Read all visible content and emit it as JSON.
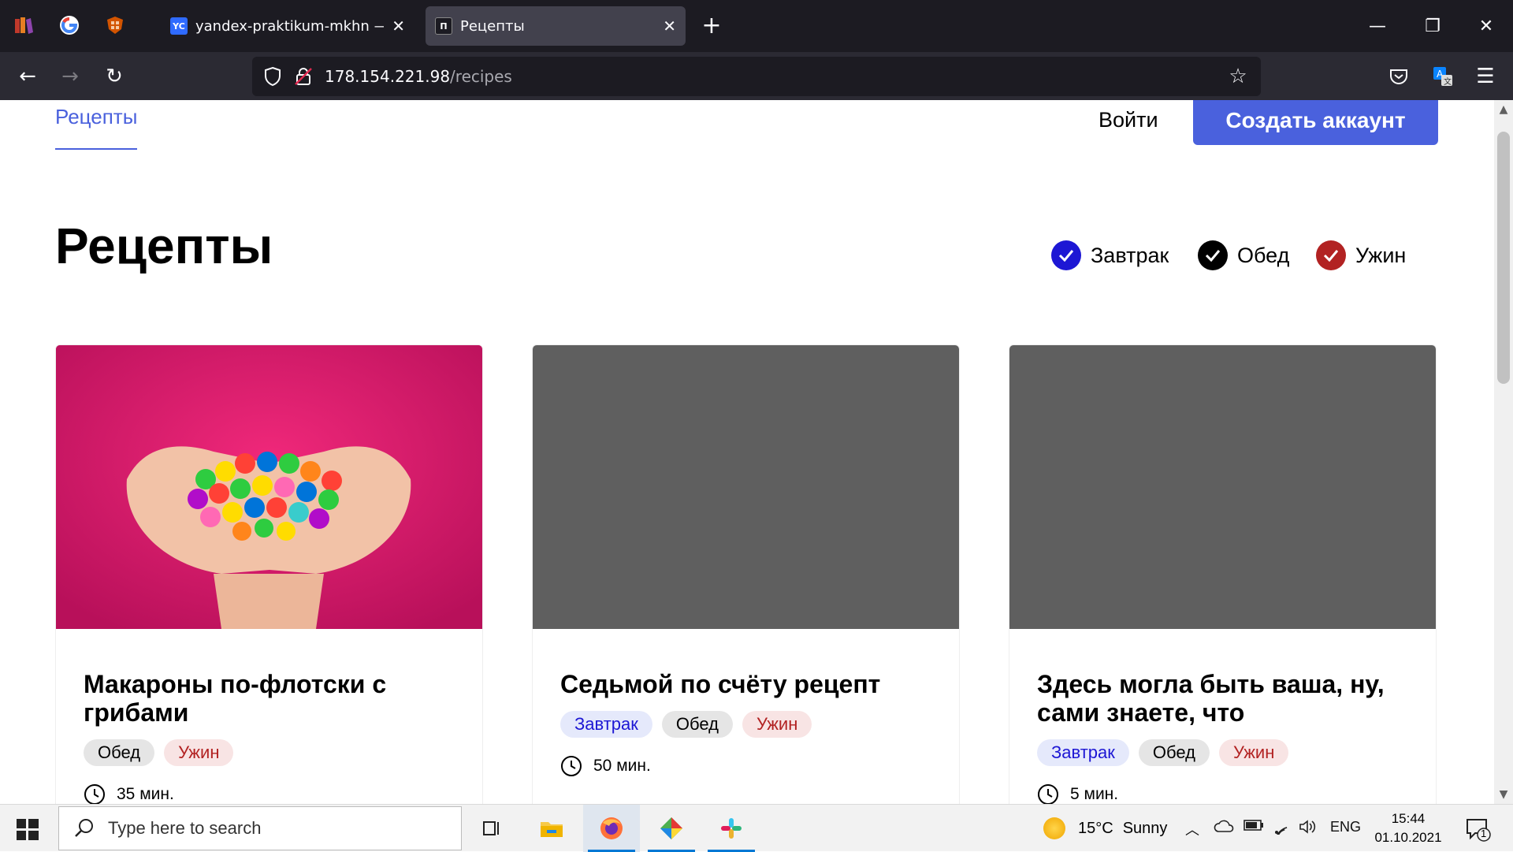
{
  "browser": {
    "tabs": [
      {
        "title": "yandex-praktikum-mkhn — Об",
        "favicon": "YC",
        "active": false
      },
      {
        "title": "Рецепты",
        "favicon": "П",
        "active": true
      }
    ],
    "new_tab_label": "+",
    "url_host": "178.154.221.98",
    "url_path": "/recipes"
  },
  "site": {
    "nav_recipes": "Рецепты",
    "login": "Войти",
    "signup": "Создать аккаунт"
  },
  "page": {
    "title": "Рецепты",
    "filters": [
      {
        "label": "Завтрак",
        "color": "#1d17d4"
      },
      {
        "label": "Обед",
        "color": "#000000"
      },
      {
        "label": "Ужин",
        "color": "#b22222"
      }
    ]
  },
  "cards": [
    {
      "title": "Макароны по-флотски с грибами",
      "tags": [
        "Обед",
        "Ужин"
      ],
      "time": "35 мин."
    },
    {
      "title": "Седьмой по счёту рецепт",
      "tags": [
        "Завтрак",
        "Обед",
        "Ужин"
      ],
      "time": "50 мин."
    },
    {
      "title": "Здесь могла быть ваша, ну, сами знаете, что",
      "tags": [
        "Завтрак",
        "Обед",
        "Ужин"
      ],
      "time": "5 мин."
    }
  ],
  "taskbar": {
    "search_placeholder": "Type here to search",
    "weather_temp": "15°C",
    "weather_desc": "Sunny",
    "lang": "ENG",
    "time": "15:44",
    "date": "01.10.2021",
    "notification_count": "1"
  }
}
